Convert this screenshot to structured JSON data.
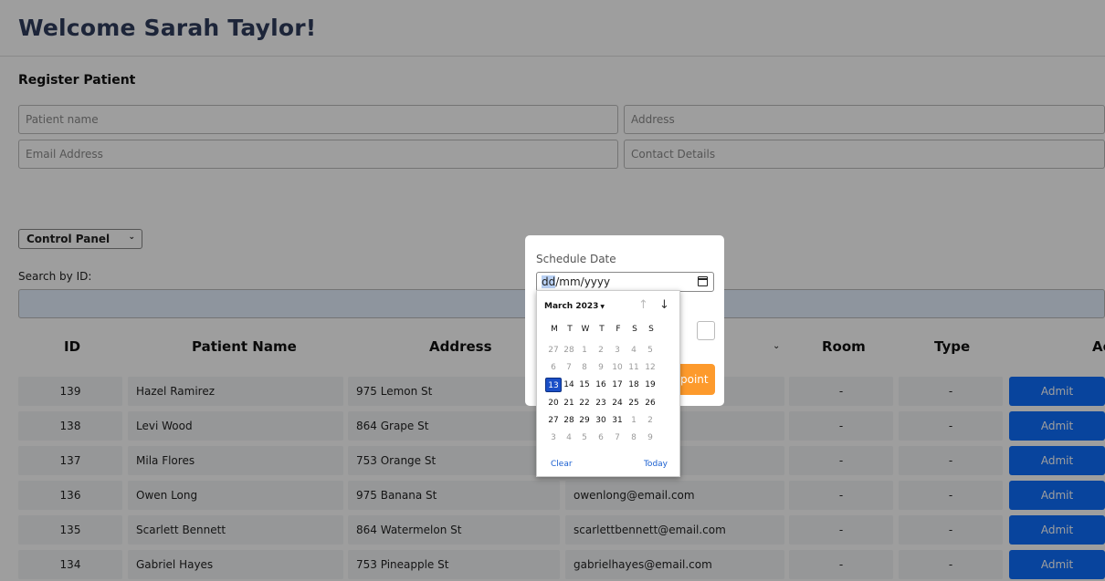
{
  "header": {
    "welcome": "Welcome Sarah Taylor!"
  },
  "register": {
    "title": "Register Patient",
    "patient_name_placeholder": "Patient name",
    "address_placeholder": "Address",
    "email_placeholder": "Email Address",
    "contact_placeholder": "Contact Details"
  },
  "panel_select": {
    "value": "Control Panel"
  },
  "search": {
    "label": "Search by ID:"
  },
  "table": {
    "headers": {
      "id": "ID",
      "name": "Patient Name",
      "address": "Address",
      "room": "Room",
      "type": "Type",
      "actions": "Ac"
    },
    "rows": [
      {
        "id": "139",
        "name": "Hazel Ramirez",
        "address": "975 Lemon St",
        "email": "",
        "room": "-",
        "type": "-",
        "action": "Admit"
      },
      {
        "id": "138",
        "name": "Levi Wood",
        "address": "864 Grape St",
        "email": "",
        "room": "-",
        "type": "-",
        "action": "Admit"
      },
      {
        "id": "137",
        "name": "Mila Flores",
        "address": "753 Orange St",
        "email": "",
        "room": "-",
        "type": "-",
        "action": "Admit"
      },
      {
        "id": "136",
        "name": "Owen Long",
        "address": "975 Banana St",
        "email": "owenlong@email.com",
        "room": "-",
        "type": "-",
        "action": "Admit"
      },
      {
        "id": "135",
        "name": "Scarlett Bennett",
        "address": "864 Watermelon St",
        "email": "scarlettbennett@email.com",
        "room": "-",
        "type": "-",
        "action": "Admit"
      },
      {
        "id": "134",
        "name": "Gabriel Hayes",
        "address": "753 Pineapple St",
        "email": "gabrielhayes@email.com",
        "room": "-",
        "type": "-",
        "action": "Admit"
      }
    ]
  },
  "modal": {
    "label": "Schedule Date",
    "date_segment": "dd",
    "date_rest": "/mm/yyyy",
    "button_partial": "point"
  },
  "calendar": {
    "month_label": "March 2023",
    "weekdays": [
      "M",
      "T",
      "W",
      "T",
      "F",
      "S",
      "S"
    ],
    "weeks": [
      [
        {
          "d": "27",
          "m": true
        },
        {
          "d": "28",
          "m": true
        },
        {
          "d": "1",
          "m": true
        },
        {
          "d": "2",
          "m": true
        },
        {
          "d": "3",
          "m": true
        },
        {
          "d": "4",
          "m": true
        },
        {
          "d": "5",
          "m": true
        }
      ],
      [
        {
          "d": "6",
          "m": true
        },
        {
          "d": "7",
          "m": true
        },
        {
          "d": "8",
          "m": true
        },
        {
          "d": "9",
          "m": true
        },
        {
          "d": "10",
          "m": true
        },
        {
          "d": "11",
          "m": true
        },
        {
          "d": "12",
          "m": true
        }
      ],
      [
        {
          "d": "13",
          "s": true
        },
        {
          "d": "14"
        },
        {
          "d": "15"
        },
        {
          "d": "16"
        },
        {
          "d": "17"
        },
        {
          "d": "18"
        },
        {
          "d": "19"
        }
      ],
      [
        {
          "d": "20"
        },
        {
          "d": "21"
        },
        {
          "d": "22"
        },
        {
          "d": "23"
        },
        {
          "d": "24"
        },
        {
          "d": "25"
        },
        {
          "d": "26"
        }
      ],
      [
        {
          "d": "27"
        },
        {
          "d": "28"
        },
        {
          "d": "29"
        },
        {
          "d": "30"
        },
        {
          "d": "31"
        },
        {
          "d": "1",
          "m": true
        },
        {
          "d": "2",
          "m": true
        }
      ],
      [
        {
          "d": "3",
          "m": true
        },
        {
          "d": "4",
          "m": true
        },
        {
          "d": "5",
          "m": true
        },
        {
          "d": "6",
          "m": true
        },
        {
          "d": "7",
          "m": true
        },
        {
          "d": "8",
          "m": true
        },
        {
          "d": "9",
          "m": true
        }
      ]
    ],
    "clear_label": "Clear",
    "today_label": "Today",
    "prev_icon": "arrow-up-icon",
    "next_icon": "arrow-down-icon"
  },
  "colors": {
    "primary": "#0d6efd",
    "accent": "#fd9a2c",
    "title": "#2f3d5c"
  }
}
